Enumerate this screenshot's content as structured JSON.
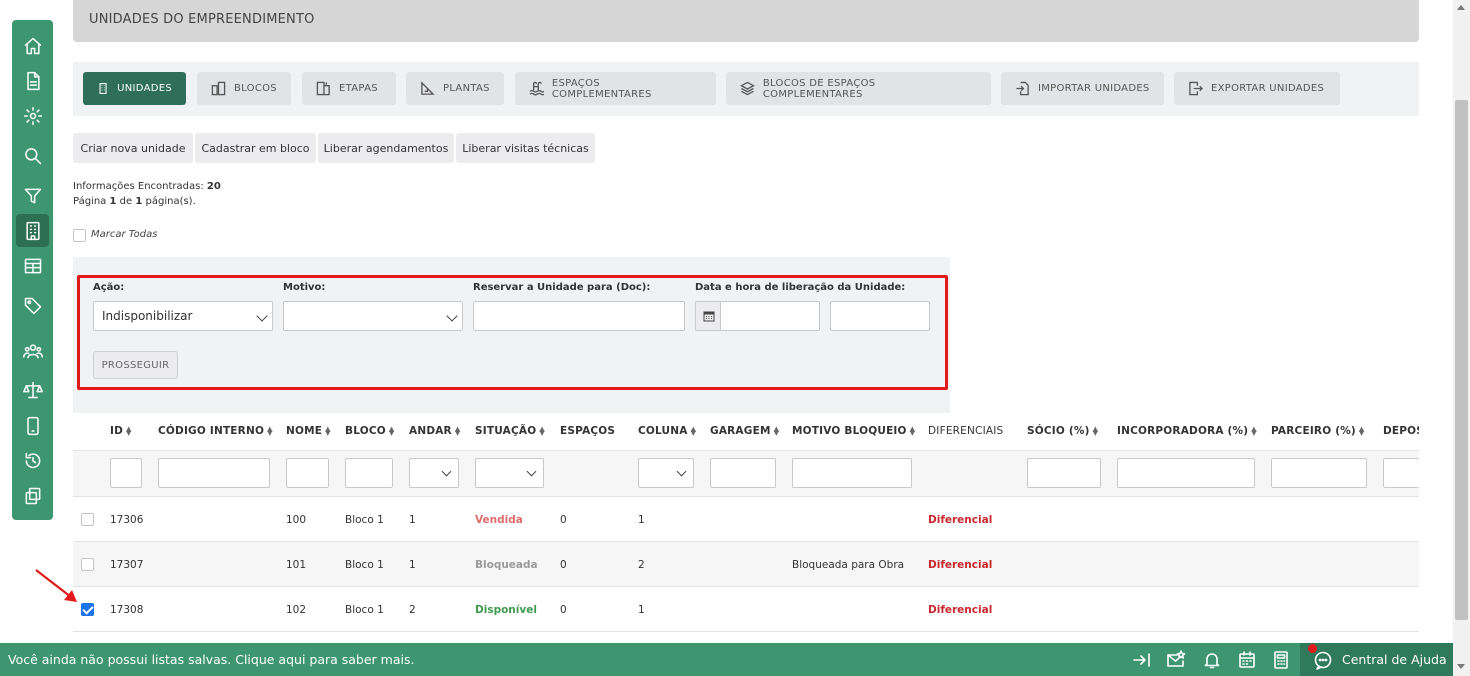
{
  "header": {
    "title": "UNIDADES DO EMPREENDIMENTO"
  },
  "sidebar": {
    "items": [
      {
        "icon": "home-icon"
      },
      {
        "icon": "document-icon"
      },
      {
        "icon": "gear-icon"
      },
      {
        "icon": "search-icon"
      },
      {
        "icon": "filter-icon"
      },
      {
        "icon": "building-icon",
        "active": true
      },
      {
        "icon": "table-icon"
      },
      {
        "icon": "tag-icon"
      },
      {
        "icon": "users-icon"
      },
      {
        "icon": "scale-icon"
      },
      {
        "icon": "mobile-icon"
      },
      {
        "icon": "history-icon"
      },
      {
        "icon": "copy-icon"
      }
    ]
  },
  "tabs": [
    {
      "label": "UNIDADES",
      "icon": "building-icon",
      "active": true
    },
    {
      "label": "BLOCOS",
      "icon": "blocks-icon"
    },
    {
      "label": "ETAPAS",
      "icon": "stages-icon"
    },
    {
      "label": "PLANTAS",
      "icon": "plan-icon"
    },
    {
      "label": "ESPAÇOS COMPLEMENTARES",
      "icon": "pool-icon"
    },
    {
      "label": "BLOCOS DE ESPAÇOS COMPLEMENTARES",
      "icon": "layers-icon"
    },
    {
      "label": "IMPORTAR UNIDADES",
      "icon": "import-icon"
    },
    {
      "label": "EXPORTAR UNIDADES",
      "icon": "export-icon"
    }
  ],
  "actions": [
    "Criar nova unidade",
    "Cadastrar em bloco",
    "Liberar agendamentos",
    "Liberar visitas técnicas"
  ],
  "info": {
    "found_label": "Informações Encontradas:",
    "found_count": "20",
    "page_prefix": "Página",
    "page_current": "1",
    "page_mid": "de",
    "page_total": "1",
    "page_suffix": "página(s)."
  },
  "mark_all": "Marcar Todas",
  "form": {
    "acao_label": "Ação:",
    "acao_value": "Indisponibilizar",
    "motivo_label": "Motivo:",
    "motivo_value": "",
    "reservar_label": "Reservar a Unidade para (Doc):",
    "data_label": "Data e hora de liberação da Unidade:",
    "submit": "PROSSEGUIR"
  },
  "table": {
    "columns": [
      "ID",
      "CÓDIGO INTERNO",
      "NOME",
      "BLOCO",
      "ANDAR",
      "SITUAÇÃO",
      "ESPAÇOS",
      "COLUNA",
      "GARAGEM",
      "MOTIVO BLOQUEIO",
      "DIFERENCIAIS",
      "SÓCIO (%)",
      "INCORPORADORA (%)",
      "PARCEIRO (%)",
      "DEPÓS"
    ],
    "rows": [
      {
        "id": "17306",
        "codigo": "",
        "nome": "100",
        "bloco": "Bloco 1",
        "andar": "1",
        "situacao": "Vendida",
        "espacos": "0",
        "coluna": "1",
        "garagem": "",
        "motivo": "",
        "diferenciais": "Diferencial",
        "checked": false
      },
      {
        "id": "17307",
        "codigo": "",
        "nome": "101",
        "bloco": "Bloco 1",
        "andar": "1",
        "situacao": "Bloqueada",
        "espacos": "0",
        "coluna": "2",
        "garagem": "",
        "motivo": "Bloqueada para Obra",
        "diferenciais": "Diferencial",
        "checked": false
      },
      {
        "id": "17308",
        "codigo": "",
        "nome": "102",
        "bloco": "Bloco 1",
        "andar": "2",
        "situacao": "Disponível",
        "espacos": "0",
        "coluna": "1",
        "garagem": "",
        "motivo": "",
        "diferenciais": "Diferencial",
        "checked": true
      }
    ]
  },
  "bottom_bar": {
    "message": "Você ainda não possui listas salvas. Clique aqui para saber mais.",
    "help_label": "Central de Ajuda",
    "icons": [
      "collapse-icon",
      "mail-star-icon",
      "bell-icon",
      "calendar-icon",
      "calculator-icon",
      "chat-icon"
    ]
  },
  "colors": {
    "primary": "#3e9670",
    "primary_dark": "#2f6f5a",
    "highlight": "#e01a1a",
    "vendida": "#e06b6b",
    "disponivel": "#3f9a4f",
    "diferencial": "#c9282d"
  }
}
